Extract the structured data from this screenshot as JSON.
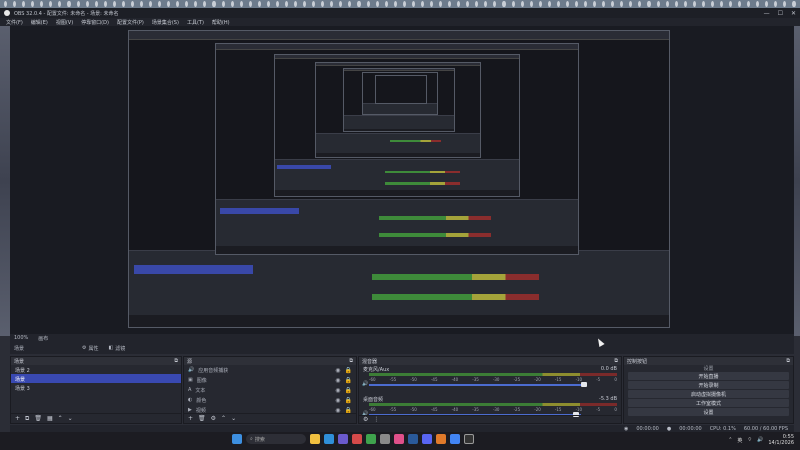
{
  "window": {
    "title": "OBS 32.0.4 - 配置文件: 未命名 - 场景: 未命名",
    "controls": [
      "—",
      "☐",
      "✕"
    ]
  },
  "menu": [
    "文件(F)",
    "编辑(E)",
    "视图(V)",
    "停靠窗口(D)",
    "配置文件(P)",
    "场景集合(S)",
    "工具(T)",
    "帮助(H)"
  ],
  "preview_controls": {
    "zoom": "100%",
    "canvas_label": "画布"
  },
  "toolbar": {
    "scene_label": "场景",
    "properties": "属性",
    "filters": "滤镜"
  },
  "scenes": {
    "header": "场景",
    "items": [
      "场景 2",
      "场景",
      "场景 3"
    ],
    "active_index": 1
  },
  "sources": {
    "header": "源",
    "items": [
      "应用音频捕获",
      "图像",
      "文本",
      "颜色",
      "视频"
    ]
  },
  "mixer": {
    "header": "混音器",
    "channels": [
      {
        "name": "麦克风/Aux",
        "db": "0.0 dB"
      },
      {
        "name": "桌面音频",
        "db": "-5.3 dB"
      }
    ],
    "ticks": [
      "-60",
      "-55",
      "-50",
      "-45",
      "-40",
      "-35",
      "-30",
      "-25",
      "-20",
      "-15",
      "-10",
      "-5",
      "0"
    ]
  },
  "controls": {
    "header": "控制按钮",
    "settings_label": "设置",
    "buttons": [
      "开始直播",
      "开始录制",
      "启动虚拟摄像机",
      "工作室模式",
      "设置"
    ]
  },
  "status": {
    "stream_time": "00:00:00",
    "rec_time": "00:00:00",
    "cpu": "CPU: 0.1%",
    "fps": "60.00 / 60.00 FPS"
  },
  "taskbar": {
    "search_placeholder": "搜索",
    "time": "0:55",
    "date": "14/1/2026",
    "lang": "英"
  },
  "colors": {
    "active_scene": "#3949b1",
    "meter_green": "#3c7d36",
    "meter_yellow": "#8d8d2f",
    "meter_red": "#7a2a2a"
  }
}
